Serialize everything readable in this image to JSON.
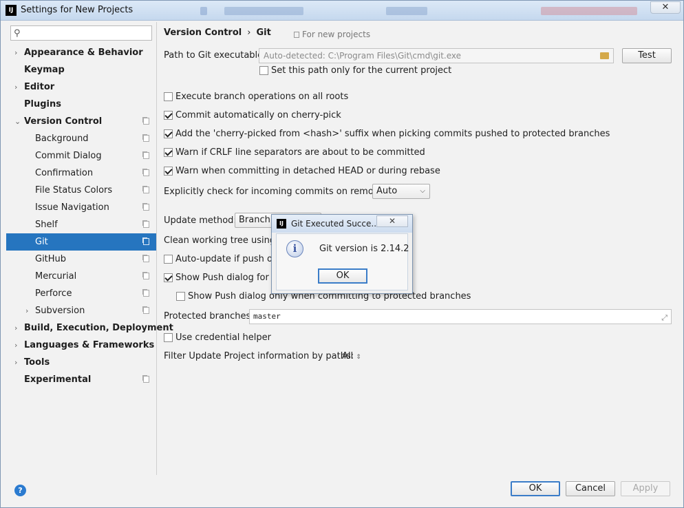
{
  "window": {
    "title": "Settings for New Projects",
    "logo_text": "IJ",
    "close_glyph": "✕"
  },
  "search": {
    "placeholder": "",
    "value": ""
  },
  "sidebar": {
    "items": [
      {
        "label": "Appearance & Behavior",
        "bold": true,
        "arrow": "›"
      },
      {
        "label": "Keymap",
        "bold": true,
        "arrow": ""
      },
      {
        "label": "Editor",
        "bold": true,
        "arrow": "›"
      },
      {
        "label": "Plugins",
        "bold": true,
        "arrow": ""
      },
      {
        "label": "Version Control",
        "bold": true,
        "arrow": "⌄"
      },
      {
        "label": "Background"
      },
      {
        "label": "Commit Dialog"
      },
      {
        "label": "Confirmation"
      },
      {
        "label": "File Status Colors"
      },
      {
        "label": "Issue Navigation"
      },
      {
        "label": "Shelf"
      },
      {
        "label": "Git",
        "selected": true
      },
      {
        "label": "GitHub"
      },
      {
        "label": "Mercurial"
      },
      {
        "label": "Perforce"
      },
      {
        "label": "Subversion",
        "arrow": "›"
      },
      {
        "label": "Build, Execution, Deployment",
        "bold": true,
        "arrow": "›"
      },
      {
        "label": "Languages & Frameworks",
        "bold": true,
        "arrow": "›"
      },
      {
        "label": "Tools",
        "bold": true,
        "arrow": "›"
      },
      {
        "label": "Experimental",
        "bold": true,
        "arrow": ""
      }
    ]
  },
  "main": {
    "breadcrumb": {
      "parent": "Version Control",
      "separator": "›",
      "current": "Git"
    },
    "scope_label": "For new projects",
    "path_label": "Path to Git executable:",
    "path_value": "Auto-detected: C:\\Program Files\\Git\\cmd\\git.exe",
    "test_button": "Test",
    "set_path_only": {
      "label": "Set this path only for the current project",
      "checked": false
    },
    "checkboxes": [
      {
        "label": "Execute branch operations on all roots",
        "checked": false
      },
      {
        "label": "Commit automatically on cherry-pick",
        "checked": true
      },
      {
        "label": "Add the 'cherry-picked from <hash>' suffix when picking commits pushed to protected branches",
        "checked": true
      },
      {
        "label": "Warn if CRLF line separators are about to be committed",
        "checked": true
      },
      {
        "label": "Warn when committing in detached HEAD or during rebase",
        "checked": true
      }
    ],
    "incoming_label": "Explicitly check for incoming commits on remotes:",
    "incoming_value": "Auto",
    "update_method_label": "Update method:",
    "update_method_value": "Branch D",
    "clean_tree_label": "Clean working tree using:",
    "auto_update": {
      "label": "Auto-update if push of t",
      "checked": false
    },
    "show_push": {
      "label": "Show Push dialog for Co",
      "checked": true
    },
    "show_push_protected": {
      "label": "Show Push dialog only when committing to protected branches",
      "checked": false
    },
    "protected_label": "Protected branches:",
    "protected_value": "master",
    "credential_helper": {
      "label": "Use credential helper",
      "checked": false
    },
    "filter_label": "Filter Update Project information by paths:",
    "filter_value": "All"
  },
  "footer": {
    "help_glyph": "?",
    "ok": "OK",
    "cancel": "Cancel",
    "apply": "Apply"
  },
  "dialog": {
    "title": "Git Executed Succe...",
    "close_glyph": "✕",
    "info_glyph": "i",
    "message": "Git version is 2.14.2",
    "ok": "OK"
  },
  "colors": {
    "selection": "#2675bf",
    "focus_border": "#3a7cc8",
    "help_icon": "#2b7bd0"
  }
}
